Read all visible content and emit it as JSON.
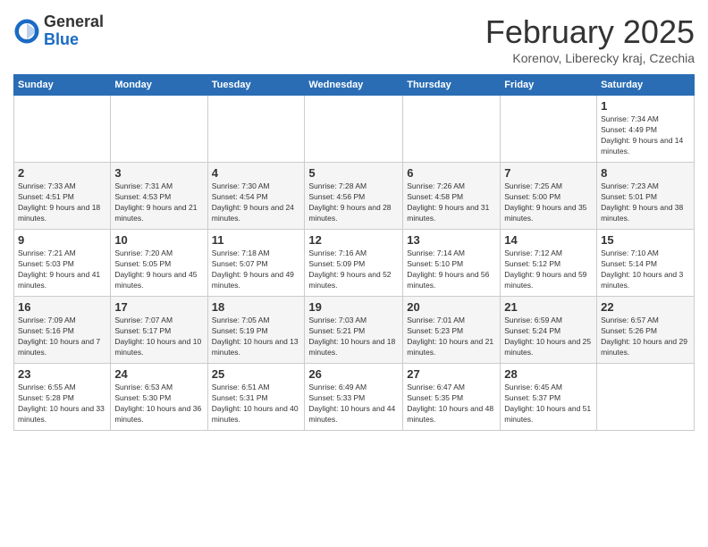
{
  "header": {
    "logo_general": "General",
    "logo_blue": "Blue",
    "title": "February 2025",
    "subtitle": "Korenov, Liberecky kraj, Czechia"
  },
  "days_of_week": [
    "Sunday",
    "Monday",
    "Tuesday",
    "Wednesday",
    "Thursday",
    "Friday",
    "Saturday"
  ],
  "weeks": [
    [
      {
        "day": "",
        "info": ""
      },
      {
        "day": "",
        "info": ""
      },
      {
        "day": "",
        "info": ""
      },
      {
        "day": "",
        "info": ""
      },
      {
        "day": "",
        "info": ""
      },
      {
        "day": "",
        "info": ""
      },
      {
        "day": "1",
        "info": "Sunrise: 7:34 AM\nSunset: 4:49 PM\nDaylight: 9 hours and 14 minutes."
      }
    ],
    [
      {
        "day": "2",
        "info": "Sunrise: 7:33 AM\nSunset: 4:51 PM\nDaylight: 9 hours and 18 minutes."
      },
      {
        "day": "3",
        "info": "Sunrise: 7:31 AM\nSunset: 4:53 PM\nDaylight: 9 hours and 21 minutes."
      },
      {
        "day": "4",
        "info": "Sunrise: 7:30 AM\nSunset: 4:54 PM\nDaylight: 9 hours and 24 minutes."
      },
      {
        "day": "5",
        "info": "Sunrise: 7:28 AM\nSunset: 4:56 PM\nDaylight: 9 hours and 28 minutes."
      },
      {
        "day": "6",
        "info": "Sunrise: 7:26 AM\nSunset: 4:58 PM\nDaylight: 9 hours and 31 minutes."
      },
      {
        "day": "7",
        "info": "Sunrise: 7:25 AM\nSunset: 5:00 PM\nDaylight: 9 hours and 35 minutes."
      },
      {
        "day": "8",
        "info": "Sunrise: 7:23 AM\nSunset: 5:01 PM\nDaylight: 9 hours and 38 minutes."
      }
    ],
    [
      {
        "day": "9",
        "info": "Sunrise: 7:21 AM\nSunset: 5:03 PM\nDaylight: 9 hours and 41 minutes."
      },
      {
        "day": "10",
        "info": "Sunrise: 7:20 AM\nSunset: 5:05 PM\nDaylight: 9 hours and 45 minutes."
      },
      {
        "day": "11",
        "info": "Sunrise: 7:18 AM\nSunset: 5:07 PM\nDaylight: 9 hours and 49 minutes."
      },
      {
        "day": "12",
        "info": "Sunrise: 7:16 AM\nSunset: 5:09 PM\nDaylight: 9 hours and 52 minutes."
      },
      {
        "day": "13",
        "info": "Sunrise: 7:14 AM\nSunset: 5:10 PM\nDaylight: 9 hours and 56 minutes."
      },
      {
        "day": "14",
        "info": "Sunrise: 7:12 AM\nSunset: 5:12 PM\nDaylight: 9 hours and 59 minutes."
      },
      {
        "day": "15",
        "info": "Sunrise: 7:10 AM\nSunset: 5:14 PM\nDaylight: 10 hours and 3 minutes."
      }
    ],
    [
      {
        "day": "16",
        "info": "Sunrise: 7:09 AM\nSunset: 5:16 PM\nDaylight: 10 hours and 7 minutes."
      },
      {
        "day": "17",
        "info": "Sunrise: 7:07 AM\nSunset: 5:17 PM\nDaylight: 10 hours and 10 minutes."
      },
      {
        "day": "18",
        "info": "Sunrise: 7:05 AM\nSunset: 5:19 PM\nDaylight: 10 hours and 13 minutes."
      },
      {
        "day": "19",
        "info": "Sunrise: 7:03 AM\nSunset: 5:21 PM\nDaylight: 10 hours and 18 minutes."
      },
      {
        "day": "20",
        "info": "Sunrise: 7:01 AM\nSunset: 5:23 PM\nDaylight: 10 hours and 21 minutes."
      },
      {
        "day": "21",
        "info": "Sunrise: 6:59 AM\nSunset: 5:24 PM\nDaylight: 10 hours and 25 minutes."
      },
      {
        "day": "22",
        "info": "Sunrise: 6:57 AM\nSunset: 5:26 PM\nDaylight: 10 hours and 29 minutes."
      }
    ],
    [
      {
        "day": "23",
        "info": "Sunrise: 6:55 AM\nSunset: 5:28 PM\nDaylight: 10 hours and 33 minutes."
      },
      {
        "day": "24",
        "info": "Sunrise: 6:53 AM\nSunset: 5:30 PM\nDaylight: 10 hours and 36 minutes."
      },
      {
        "day": "25",
        "info": "Sunrise: 6:51 AM\nSunset: 5:31 PM\nDaylight: 10 hours and 40 minutes."
      },
      {
        "day": "26",
        "info": "Sunrise: 6:49 AM\nSunset: 5:33 PM\nDaylight: 10 hours and 44 minutes."
      },
      {
        "day": "27",
        "info": "Sunrise: 6:47 AM\nSunset: 5:35 PM\nDaylight: 10 hours and 48 minutes."
      },
      {
        "day": "28",
        "info": "Sunrise: 6:45 AM\nSunset: 5:37 PM\nDaylight: 10 hours and 51 minutes."
      },
      {
        "day": "",
        "info": ""
      }
    ]
  ]
}
